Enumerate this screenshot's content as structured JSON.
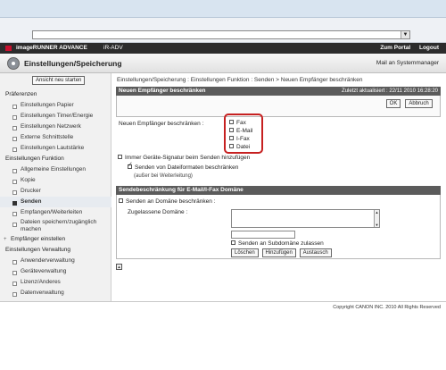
{
  "app": {
    "brand": "imageRUNNER ADVANCE",
    "device": "iR-ADV",
    "top_links": [
      "Zum Portal",
      "Logout"
    ],
    "page_title": "Einstellungen/Speicherung",
    "system_manager": "Mail an Systemmanager"
  },
  "sidebar": {
    "reset_label": "Ansicht neu starten",
    "items": [
      {
        "label": "Präferenzen",
        "type": "cat"
      },
      {
        "label": "Einstellungen Papier",
        "type": "sub"
      },
      {
        "label": "Einstellungen Timer/Energie",
        "type": "sub"
      },
      {
        "label": "Einstellungen Netzwerk",
        "type": "sub"
      },
      {
        "label": "Externe Schnittstelle",
        "type": "sub"
      },
      {
        "label": "Einstellungen Lautstärke",
        "type": "sub"
      },
      {
        "label": "Einstellungen Funktion",
        "type": "cat"
      },
      {
        "label": "Allgemeine Einstellungen",
        "type": "sub"
      },
      {
        "label": "Kopie",
        "type": "sub"
      },
      {
        "label": "Drucker",
        "type": "sub"
      },
      {
        "label": "Senden",
        "type": "sub",
        "active": true
      },
      {
        "label": "Empfangen/Weiterleiten",
        "type": "sub"
      },
      {
        "label": "Dateien speichern/zugänglich machen",
        "type": "sub"
      },
      {
        "label": "Empfänger einstellen",
        "type": "expand"
      },
      {
        "label": "Einstellungen Verwaltung",
        "type": "cat"
      },
      {
        "label": "Anwenderverwaltung",
        "type": "sub"
      },
      {
        "label": "Geräteverwaltung",
        "type": "sub"
      },
      {
        "label": "Lizenz/Anderes",
        "type": "sub"
      },
      {
        "label": "Datenverwaltung",
        "type": "sub"
      }
    ]
  },
  "main": {
    "breadcrumb": "Einstellungen/Speicherung : Einstellungen Funktion : Senden > Neuen Empfänger beschränken",
    "section_title": "Neuen Empfänger beschränken",
    "updated": "Zuletzt aktualisiert : 22/11 2010 16:28:20",
    "ok": "OK",
    "cancel": "Abbruch",
    "restrict_label": "Neuen Empfänger beschränken :",
    "checkboxes": [
      {
        "label": "Fax",
        "checked": false
      },
      {
        "label": "E-Mail",
        "checked": false
      },
      {
        "label": "I-Fax",
        "checked": false
      },
      {
        "label": "Datei",
        "checked": false
      }
    ],
    "signature_label": "Immer Geräte-Signatur beim Senden hinzufügen",
    "formats_label": "Senden von Dateiformaten beschränken",
    "except_note": "(außer bei Weiterleitung)",
    "domain_section_title": "Sendebeschränkung für E-Mail/I-Fax Domäne",
    "domain_restrict_label": "Senden an Domäne beschränken :",
    "allowed_domain_label": "Zugelassene Domäne :",
    "subdomain_label": "Senden an Subdomäne zulassen",
    "buttons": [
      "Löschen",
      "Hinzufügen",
      "Austausch"
    ]
  },
  "footer": {
    "copyright": "Copyright CANON INC. 2010 All Rights Reserved"
  }
}
